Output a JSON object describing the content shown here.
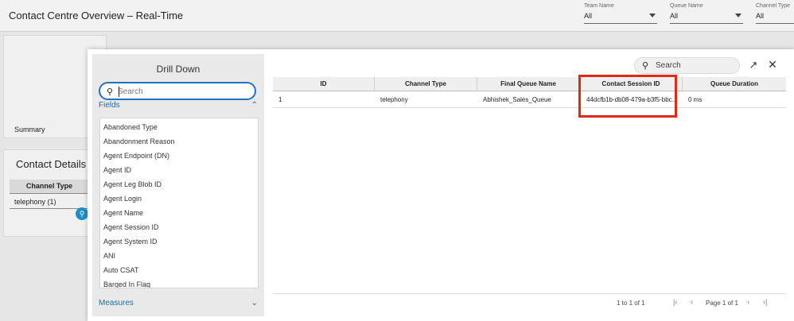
{
  "dashboard": {
    "title": "Contact Centre Overview – Real-Time",
    "filters": [
      {
        "label": "Team Name",
        "value": "All"
      },
      {
        "label": "Queue Name",
        "value": "All"
      },
      {
        "label": "Channel Type",
        "value": "All"
      }
    ],
    "summary_label": "Summary",
    "contact_details_title": "Contact Details C",
    "channel_column": "Channel Type",
    "channel_row": "telephony (1)"
  },
  "drilldown": {
    "title": "Drill Down",
    "search_placeholder": "Search",
    "fields_label": "Fields",
    "measures_label": "Measures",
    "fields": [
      "Abandoned Type",
      "Abandonment Reason",
      "Agent Endpoint (DN)",
      "Agent ID",
      "Agent Leg Blob ID",
      "Agent Login",
      "Agent Name",
      "Agent Session ID",
      "Agent System ID",
      "ANI",
      "Auto CSAT",
      "Barged In Flag"
    ]
  },
  "grid": {
    "search_placeholder": "Search",
    "columns": [
      "ID",
      "Channel Type",
      "Final Queue Name",
      "Contact Session ID",
      "Queue Duration"
    ],
    "rows": [
      [
        "1",
        "telephony",
        "Abhishek_Sales_Queue",
        "44dcfb1b-db08-479a-b3f5-bbc...",
        "0 ms"
      ]
    ],
    "highlight_color": "#e0291a"
  },
  "pagination": {
    "count": "1 to 1 of 1",
    "page": "Page 1 of 1",
    "first_icon": "first-page-icon",
    "prev_icon": "prev-page-icon",
    "next_icon": "next-page-icon",
    "last_icon": "last-page-icon"
  }
}
